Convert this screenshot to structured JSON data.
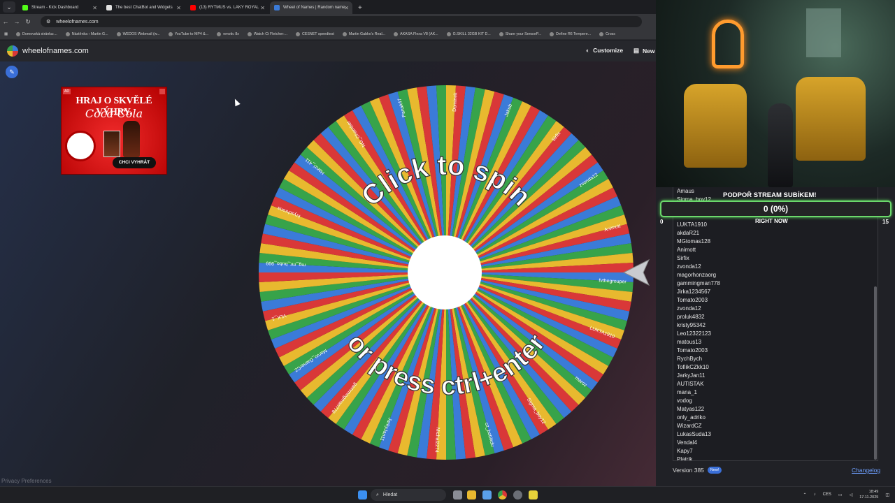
{
  "browser": {
    "tabs": [
      {
        "label": "Stream - Kick Dashboard",
        "icon": "kick-icon",
        "color": "#53fc18",
        "active": false
      },
      {
        "label": "The best ChatBot and Widgets",
        "icon": "botrix-icon",
        "color": "#e0e0e0",
        "active": false
      },
      {
        "label": "(13) RYTMUS vs. LAKY ROYAL",
        "icon": "youtube-icon",
        "color": "#ff0000",
        "active": false
      },
      {
        "label": "Wheel of Names | Random name",
        "icon": "wheel-icon",
        "color": "#3b7bd8",
        "active": true
      }
    ],
    "url": "wheelofnames.com",
    "bookmarks": [
      "Domovská stránka:...",
      "Nástěnka ‹ Martin G...",
      "WEDOS Webmail (w...",
      "YouTube to MP4 &...",
      "emotic 8x",
      "Watch Ct Fletcher:...",
      "CESNET speedtest",
      "Martin Gabko's Real...",
      "AKASA Flexa V8 (AK...",
      "G.SKILL 32GB KIT D...",
      "Share your SensorP...",
      "Define R6 Tempere...",
      "Cross"
    ]
  },
  "site": {
    "name": "wheelofnames.com",
    "customize_label": "Customize",
    "new_label": "New"
  },
  "ad": {
    "tag": "AD",
    "headline": "HRAJ O SKVĚLÉ VÝHRY.",
    "brand": "Coca-Cola",
    "cta": "CHCI VYHRÁT"
  },
  "wheel": {
    "top_text": "Click to spin",
    "bottom_text": "or press ctrl+enter",
    "colors": [
      "#3b7bd8",
      "#37a34a",
      "#e8b92f",
      "#d93838"
    ],
    "segment_count": 120,
    "visible_names": [
      "fvthegrouper",
      "LUKTA1910",
      "maroz",
      "Sigma_boy12",
      "cz_bobikdu",
      "Michal2274",
      "JarkyJan11",
      "gammingman778",
      "Marvo_GamerCZ",
      "VLK_1",
      "mg_mr_bubo_999",
      "kryschrona",
      "Hanzi_411",
      "NG_Chamber",
      "Panak47",
      "Dominek",
      "Jakub",
      "Sirfix",
      "zvonda12",
      "Animott"
    ]
  },
  "overlay": {
    "title": "PODPOŘ STREAM SUBÍKEM!",
    "progress_text": "0 (0%)",
    "progress": 0,
    "min": "0",
    "max": "15",
    "subtitle": "RIGHT NOW"
  },
  "entries": [
    "Amaus",
    "Sigma_boy12",
    "",
    "",
    "LUKTA1910",
    "akdaR21",
    "MGtomas128",
    "Animott",
    "Sirfix",
    "zvonda12",
    "magorhonzaorg",
    "gammingman778",
    "Jirka1234567",
    "Tomato2003",
    "zvonda12",
    "proluk4832",
    "kristy95342",
    "Leo12322123",
    "matous13",
    "Tomato2003",
    "RychBych",
    "TofiikCZkk10",
    "JarkyJan11",
    "AUTISTAK",
    "mana_1",
    "vodog",
    "Matyas122",
    "only_adriko",
    "WizardCZ",
    "LukasSuda13",
    "Vendal4",
    "Kapy7",
    "Platrik"
  ],
  "footer": {
    "version": "Version 385",
    "badge": "New!",
    "changelog": "Changelog",
    "privacy": "Privacy Preferences"
  },
  "taskbar": {
    "search_placeholder": "Hledat",
    "lang": "CES",
    "time": "18:49",
    "date": "17.11.2025"
  }
}
